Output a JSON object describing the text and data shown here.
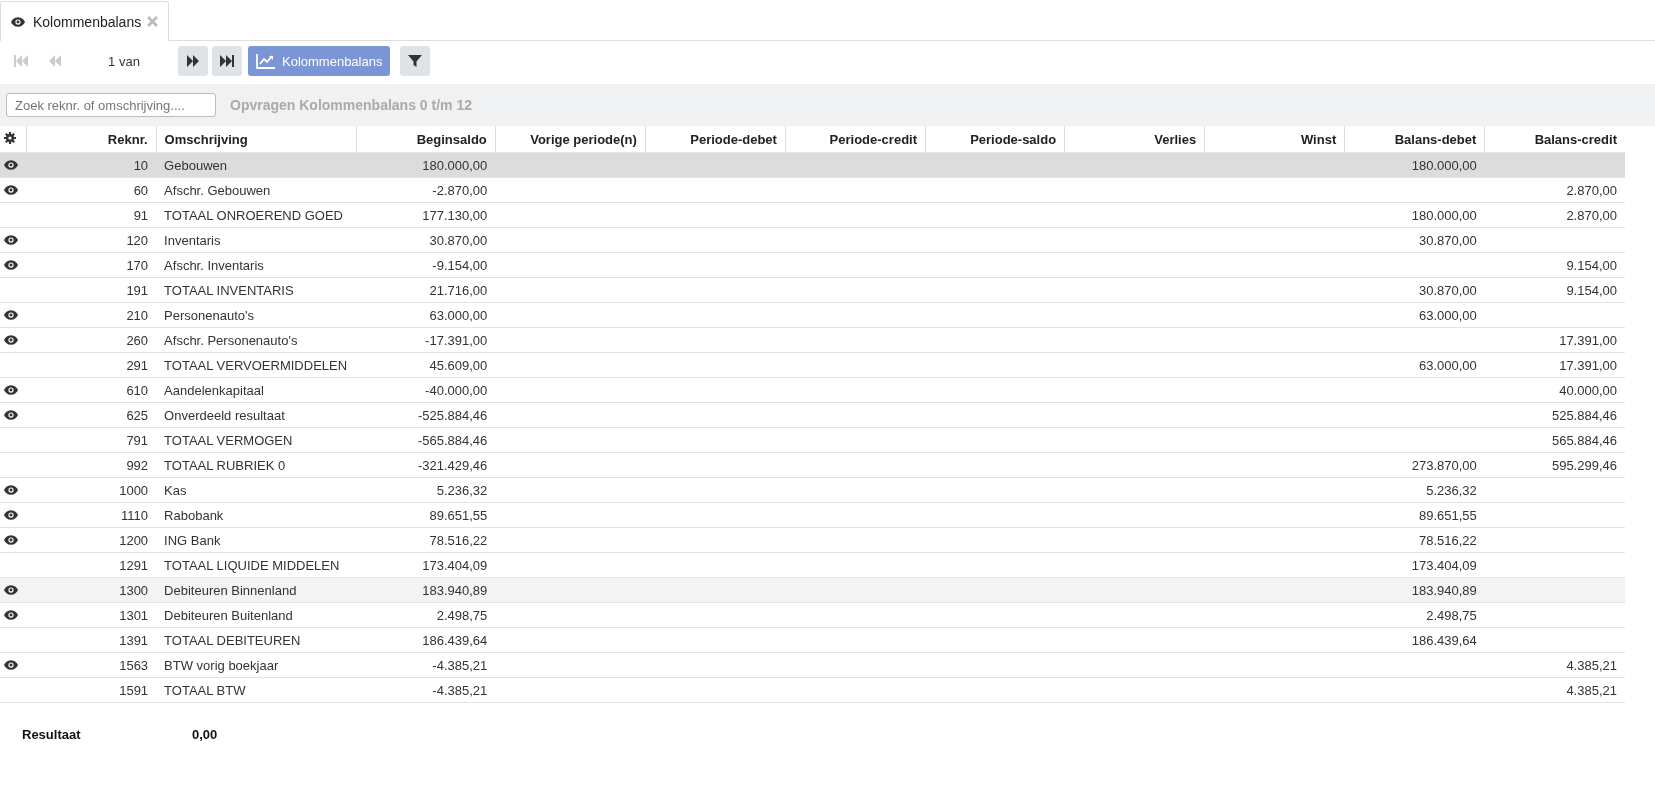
{
  "tab": {
    "label": "Kolommenbalans",
    "selected": true
  },
  "toolbar": {
    "first_disabled": true,
    "previous_disabled": true,
    "page_label": "1 van",
    "next_disabled": false,
    "last_disabled": false,
    "report_button": "Kolommenbalans"
  },
  "search": {
    "placeholder": "Zoek reknr. of omschrijving...."
  },
  "query_title": "Opvragen Kolommenbalans 0 t/m 12",
  "table": {
    "columns": [
      "Reknr.",
      "Omschrijving",
      "Beginsaldo",
      "Vorige periode(n)",
      "Periode-debet",
      "Periode-credit",
      "Periode-saldo",
      "Verlies",
      "Winst",
      "Balans-debet",
      "Balans-credit"
    ],
    "rows": [
      {
        "viewable": true,
        "selected": true,
        "hovered": false,
        "reknr": "10",
        "omschrijving": "Gebouwen",
        "beginsaldo": "180.000,00",
        "balans_debet": "180.000,00"
      },
      {
        "viewable": true,
        "selected": false,
        "hovered": false,
        "reknr": "60",
        "omschrijving": "Afschr. Gebouwen",
        "beginsaldo": "-2.870,00",
        "balans_credit": "2.870,00"
      },
      {
        "viewable": false,
        "selected": false,
        "hovered": false,
        "reknr": "91",
        "omschrijving": "TOTAAL ONROEREND GOED",
        "beginsaldo": "177.130,00",
        "balans_debet": "180.000,00",
        "balans_credit": "2.870,00"
      },
      {
        "viewable": true,
        "selected": false,
        "hovered": false,
        "reknr": "120",
        "omschrijving": "Inventaris",
        "beginsaldo": "30.870,00",
        "balans_debet": "30.870,00"
      },
      {
        "viewable": true,
        "selected": false,
        "hovered": false,
        "reknr": "170",
        "omschrijving": "Afschr. Inventaris",
        "beginsaldo": "-9.154,00",
        "balans_credit": "9.154,00"
      },
      {
        "viewable": false,
        "selected": false,
        "hovered": false,
        "reknr": "191",
        "omschrijving": "TOTAAL INVENTARIS",
        "beginsaldo": "21.716,00",
        "balans_debet": "30.870,00",
        "balans_credit": "9.154,00"
      },
      {
        "viewable": true,
        "selected": false,
        "hovered": false,
        "reknr": "210",
        "omschrijving": "Personenauto's",
        "beginsaldo": "63.000,00",
        "balans_debet": "63.000,00"
      },
      {
        "viewable": true,
        "selected": false,
        "hovered": false,
        "reknr": "260",
        "omschrijving": "Afschr. Personenauto's",
        "beginsaldo": "-17.391,00",
        "balans_credit": "17.391,00"
      },
      {
        "viewable": false,
        "selected": false,
        "hovered": false,
        "reknr": "291",
        "omschrijving": "TOTAAL VERVOERMIDDELEN",
        "beginsaldo": "45.609,00",
        "balans_debet": "63.000,00",
        "balans_credit": "17.391,00"
      },
      {
        "viewable": true,
        "selected": false,
        "hovered": false,
        "reknr": "610",
        "omschrijving": "Aandelenkapitaal",
        "beginsaldo": "-40.000,00",
        "balans_credit": "40.000,00"
      },
      {
        "viewable": true,
        "selected": false,
        "hovered": false,
        "reknr": "625",
        "omschrijving": "Onverdeeld resultaat",
        "beginsaldo": "-525.884,46",
        "balans_credit": "525.884,46"
      },
      {
        "viewable": false,
        "selected": false,
        "hovered": false,
        "reknr": "791",
        "omschrijving": "TOTAAL VERMOGEN",
        "beginsaldo": "-565.884,46",
        "balans_credit": "565.884,46"
      },
      {
        "viewable": false,
        "selected": false,
        "hovered": false,
        "reknr": "992",
        "omschrijving": "TOTAAL RUBRIEK 0",
        "beginsaldo": "-321.429,46",
        "balans_debet": "273.870,00",
        "balans_credit": "595.299,46"
      },
      {
        "viewable": true,
        "selected": false,
        "hovered": false,
        "reknr": "1000",
        "omschrijving": "Kas",
        "beginsaldo": "5.236,32",
        "balans_debet": "5.236,32"
      },
      {
        "viewable": true,
        "selected": false,
        "hovered": false,
        "reknr": "1110",
        "omschrijving": "Rabobank",
        "beginsaldo": "89.651,55",
        "balans_debet": "89.651,55"
      },
      {
        "viewable": true,
        "selected": false,
        "hovered": false,
        "reknr": "1200",
        "omschrijving": "ING Bank",
        "beginsaldo": "78.516,22",
        "balans_debet": "78.516,22"
      },
      {
        "viewable": false,
        "selected": false,
        "hovered": false,
        "reknr": "1291",
        "omschrijving": "TOTAAL LIQUIDE MIDDELEN",
        "beginsaldo": "173.404,09",
        "balans_debet": "173.404,09"
      },
      {
        "viewable": true,
        "selected": false,
        "hovered": true,
        "reknr": "1300",
        "omschrijving": "Debiteuren Binnenland",
        "beginsaldo": "183.940,89",
        "balans_debet": "183.940,89"
      },
      {
        "viewable": true,
        "selected": false,
        "hovered": false,
        "reknr": "1301",
        "omschrijving": "Debiteuren Buitenland",
        "beginsaldo": "2.498,75",
        "balans_debet": "2.498,75"
      },
      {
        "viewable": false,
        "selected": false,
        "hovered": false,
        "reknr": "1391",
        "omschrijving": "TOTAAL DEBITEUREN",
        "beginsaldo": "186.439,64",
        "balans_debet": "186.439,64"
      },
      {
        "viewable": true,
        "selected": false,
        "hovered": false,
        "reknr": "1563",
        "omschrijving": "BTW vorig boekjaar",
        "beginsaldo": "-4.385,21",
        "balans_credit": "4.385,21"
      },
      {
        "viewable": false,
        "selected": false,
        "hovered": false,
        "reknr": "1591",
        "omschrijving": "TOTAAL BTW",
        "beginsaldo": "-4.385,21",
        "balans_credit": "4.385,21"
      }
    ]
  },
  "result": {
    "label": "Resultaat",
    "value": "0,00"
  }
}
